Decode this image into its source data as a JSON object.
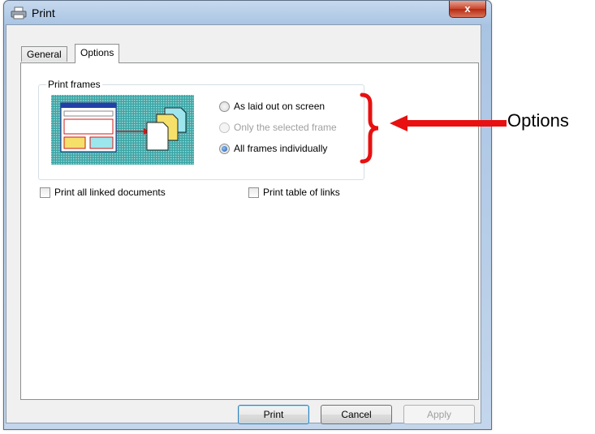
{
  "window": {
    "title": "Print",
    "close_glyph": "x"
  },
  "tabs": [
    {
      "label": "General",
      "selected": false
    },
    {
      "label": "Options",
      "selected": true
    }
  ],
  "print_frames": {
    "group_label": "Print frames",
    "options": [
      {
        "label": "As laid out on screen",
        "checked": false,
        "enabled": true
      },
      {
        "label": "Only the selected frame",
        "checked": false,
        "enabled": false
      },
      {
        "label": "All frames individually",
        "checked": true,
        "enabled": true
      }
    ]
  },
  "checkboxes": [
    {
      "label": "Print all linked documents",
      "checked": false
    },
    {
      "label": "Print table of links",
      "checked": false
    }
  ],
  "buttons": {
    "print": "Print",
    "cancel": "Cancel",
    "apply": "Apply"
  },
  "annotation": {
    "text": "Options",
    "color": "#e81010"
  },
  "icons": [
    "printer-icon",
    "close-icon",
    "print-frames-illustration"
  ]
}
